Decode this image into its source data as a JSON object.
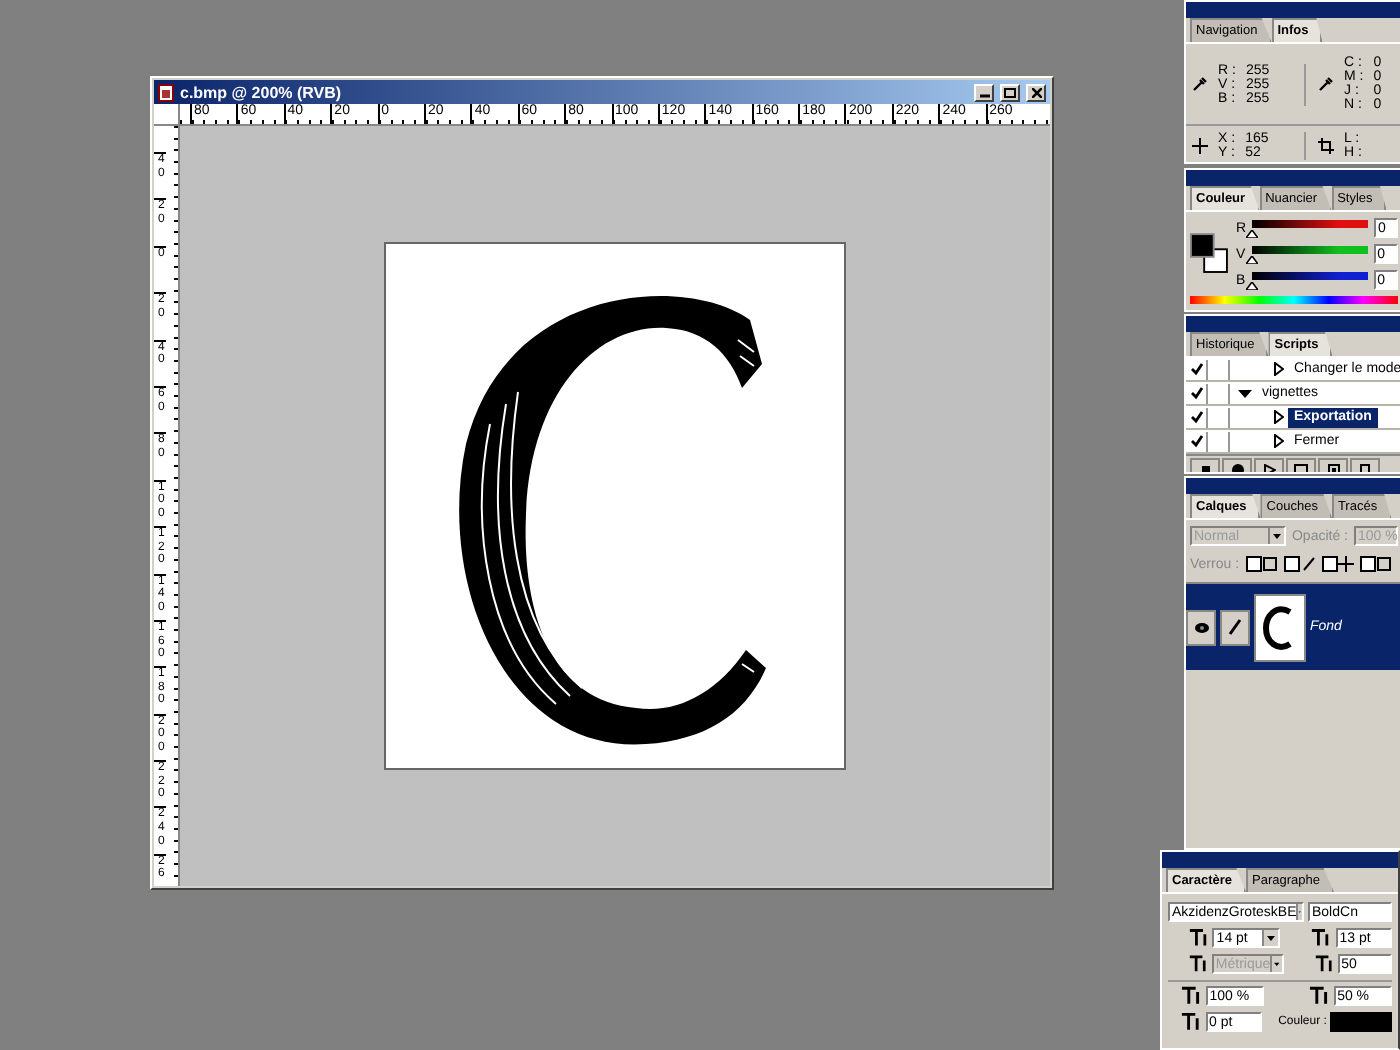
{
  "document": {
    "title": "c.bmp @ 200% (RVB)",
    "top_ruler": [
      "80",
      "60",
      "40",
      "20",
      "0",
      "20",
      "40",
      "60",
      "80",
      "100",
      "120",
      "140",
      "160",
      "180",
      "200",
      "220",
      "240",
      "260"
    ],
    "left_ruler": [
      "40",
      "20",
      "0",
      "20",
      "40",
      "60",
      "80",
      "100",
      "120",
      "140",
      "160",
      "180",
      "200",
      "220",
      "240",
      "26"
    ]
  },
  "info_panel": {
    "tabs": [
      {
        "label": "Navigation",
        "selected": false
      },
      {
        "label": "Infos",
        "selected": true
      }
    ],
    "rgb": [
      {
        "label": "R :",
        "value": "255"
      },
      {
        "label": "V :",
        "value": "255"
      },
      {
        "label": "B :",
        "value": "255"
      }
    ],
    "cmyk": [
      {
        "label": "C :",
        "value": "0"
      },
      {
        "label": "M :",
        "value": "0"
      },
      {
        "label": "J :",
        "value": "0"
      },
      {
        "label": "N :",
        "value": "0"
      }
    ],
    "position": [
      {
        "label": "X :",
        "value": "165"
      },
      {
        "label": "Y :",
        "value": "52"
      }
    ],
    "size": [
      {
        "label": "L :"
      },
      {
        "label": "H :"
      }
    ]
  },
  "color_panel": {
    "tabs": [
      {
        "label": "Couleur",
        "selected": true
      },
      {
        "label": "Nuancier",
        "selected": false
      },
      {
        "label": "Styles",
        "selected": false
      }
    ],
    "sliders": [
      {
        "label": "R",
        "value": "0",
        "color": "#e01010",
        "level": 0
      },
      {
        "label": "V",
        "value": "0",
        "color": "#10c020",
        "level": 0
      },
      {
        "label": "B",
        "value": "0",
        "color": "#1020d0",
        "level": 0
      }
    ]
  },
  "history_panel": {
    "tabs": [
      {
        "label": "Historique",
        "selected": false
      },
      {
        "label": "Scripts",
        "selected": true
      }
    ],
    "rows": [
      {
        "kind": "action",
        "label": "Changer le mode",
        "checked": true,
        "selected": false
      },
      {
        "kind": "set",
        "label": "vignettes",
        "checked": true,
        "selected": false,
        "expanded": true,
        "children": [
          {
            "kind": "action",
            "label": "Exportation",
            "checked": true,
            "selected": true
          },
          {
            "kind": "action",
            "label": "Fermer",
            "checked": true,
            "selected": false
          }
        ]
      }
    ]
  },
  "layers_panel": {
    "tabs": [
      {
        "label": "Calques",
        "selected": true
      },
      {
        "label": "Couches",
        "selected": false
      },
      {
        "label": "Tracés",
        "selected": false
      }
    ],
    "blend_mode": "Normal",
    "opacity_label": "Opacité :",
    "opacity": "100 %",
    "lock_label": "Verrou :",
    "layers": [
      {
        "name": "Fond",
        "selected": true,
        "visible": true
      }
    ]
  },
  "character_panel": {
    "tabs": [
      {
        "label": "Caractère",
        "selected": true
      },
      {
        "label": "Paragraphe",
        "selected": false
      }
    ],
    "font_family": "AkzidenzGroteskBE",
    "font_style": "BoldCn",
    "size": "14 pt",
    "leading": "13 pt",
    "kerning": "Métrique",
    "tracking": "50",
    "vertical_scale": "100 %",
    "horizontal_scale": "50 %",
    "baseline": "0 pt",
    "color_label": "Couleur :"
  }
}
